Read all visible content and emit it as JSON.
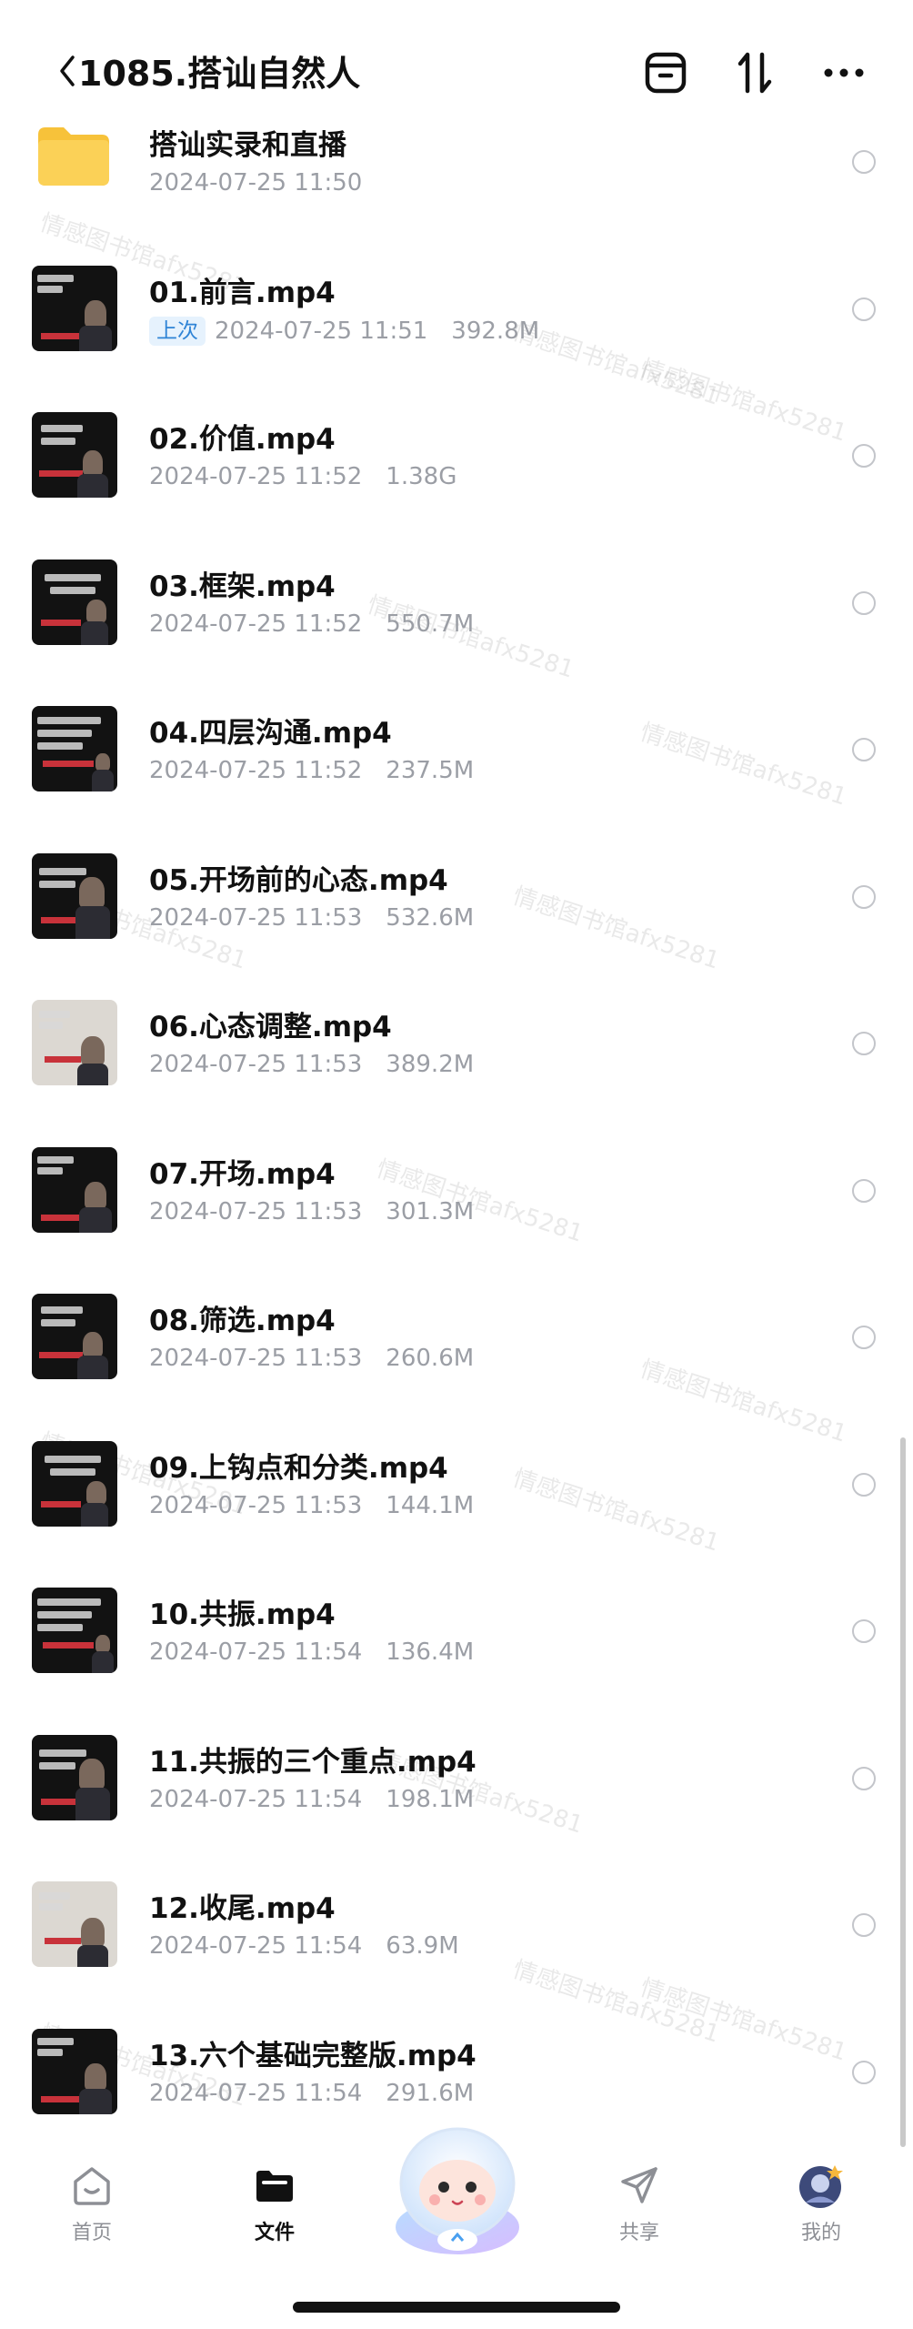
{
  "header": {
    "title": "1085.搭讪自然人"
  },
  "files": [
    {
      "name": "搭讪实录和直播",
      "date": "2024-07-25 11:50",
      "size": "",
      "badge": "",
      "kind": "folder"
    },
    {
      "name": "01.前言.mp4",
      "date": "2024-07-25 11:51",
      "size": "392.8M",
      "badge": "上次",
      "kind": "video"
    },
    {
      "name": "02.价值.mp4",
      "date": "2024-07-25 11:52",
      "size": "1.38G",
      "badge": "",
      "kind": "video"
    },
    {
      "name": "03.框架.mp4",
      "date": "2024-07-25 11:52",
      "size": "550.7M",
      "badge": "",
      "kind": "video"
    },
    {
      "name": "04.四层沟通.mp4",
      "date": "2024-07-25 11:52",
      "size": "237.5M",
      "badge": "",
      "kind": "video"
    },
    {
      "name": "05.开场前的心态.mp4",
      "date": "2024-07-25 11:53",
      "size": "532.6M",
      "badge": "",
      "kind": "video"
    },
    {
      "name": "06.心态调整.mp4",
      "date": "2024-07-25 11:53",
      "size": "389.2M",
      "badge": "",
      "kind": "video"
    },
    {
      "name": "07.开场.mp4",
      "date": "2024-07-25 11:53",
      "size": "301.3M",
      "badge": "",
      "kind": "video"
    },
    {
      "name": "08.筛选.mp4",
      "date": "2024-07-25 11:53",
      "size": "260.6M",
      "badge": "",
      "kind": "video"
    },
    {
      "name": "09.上钩点和分类.mp4",
      "date": "2024-07-25 11:53",
      "size": "144.1M",
      "badge": "",
      "kind": "video"
    },
    {
      "name": "10.共振.mp4",
      "date": "2024-07-25 11:54",
      "size": "136.4M",
      "badge": "",
      "kind": "video"
    },
    {
      "name": "11.共振的三个重点.mp4",
      "date": "2024-07-25 11:54",
      "size": "198.1M",
      "badge": "",
      "kind": "video"
    },
    {
      "name": "12.收尾.mp4",
      "date": "2024-07-25 11:54",
      "size": "63.9M",
      "badge": "",
      "kind": "video"
    },
    {
      "name": "13.六个基础完整版.mp4",
      "date": "2024-07-25 11:54",
      "size": "291.6M",
      "badge": "",
      "kind": "video"
    }
  ],
  "tabbar": {
    "home": "首页",
    "files": "文件",
    "share": "共享",
    "mine": "我的"
  },
  "watermark": "情感图书馆afx5281",
  "colors": {
    "accent": "#2f84d6",
    "badge_bg": "#e6f2fd",
    "folder": "#f7c23a",
    "meta_text": "#9b9ea5"
  }
}
